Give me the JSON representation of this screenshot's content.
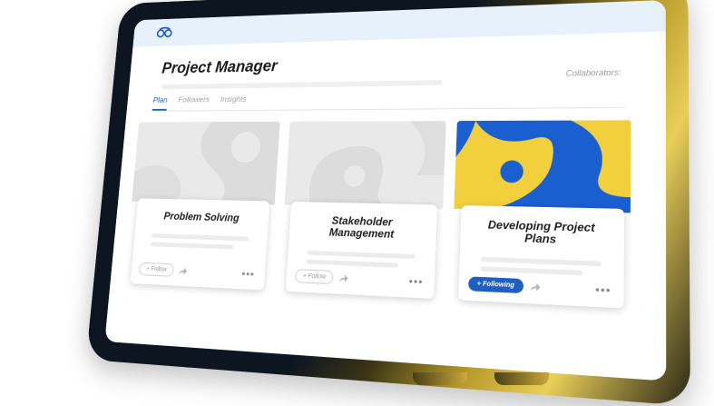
{
  "header": {
    "title": "Project Manager",
    "collaborators_label": "Collaborators:"
  },
  "tabs": [
    {
      "label": "Plan",
      "active": true
    },
    {
      "label": "Followers",
      "active": false
    },
    {
      "label": "Insights",
      "active": false
    }
  ],
  "cards": [
    {
      "title": "Problem Solving",
      "button": "+ Follow",
      "following": false,
      "image": "gray-abstract"
    },
    {
      "title": "Stakeholder Management",
      "button": "+ Follow",
      "following": false,
      "image": "gray-abstract"
    },
    {
      "title": "Developing Project Plans",
      "button": "+ Following",
      "following": true,
      "image": "blue-yellow-abstract"
    }
  ],
  "colors": {
    "accent": "#1f5fc4",
    "highlight": "#f2cf3d",
    "frame_dark": "#0d1620",
    "frame_gold": "#e9cf5a"
  },
  "icons": {
    "logo": "infinity-logo-icon",
    "share": "share-arrow-icon",
    "more": "more-dots-icon"
  }
}
